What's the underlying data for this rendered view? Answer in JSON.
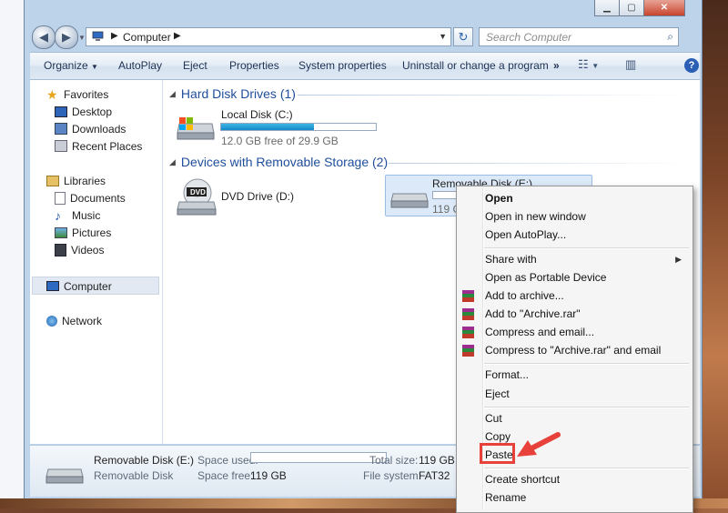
{
  "address": {
    "crumb": "Computer"
  },
  "search": {
    "placeholder": "Search Computer"
  },
  "toolbar": {
    "organize": "Organize",
    "autoplay": "AutoPlay",
    "eject": "Eject",
    "properties": "Properties",
    "system_properties": "System properties",
    "uninstall": "Uninstall or change a program",
    "more": "»"
  },
  "nav": {
    "favorites": "Favorites",
    "desktop": "Desktop",
    "downloads": "Downloads",
    "recent_places": "Recent Places",
    "libraries": "Libraries",
    "documents": "Documents",
    "music": "Music",
    "pictures": "Pictures",
    "videos": "Videos",
    "computer": "Computer",
    "network": "Network"
  },
  "groups": {
    "hdd": "Hard Disk Drives (1)",
    "removable": "Devices with Removable Storage (2)"
  },
  "drives": {
    "local_name": "Local Disk (C:)",
    "local_free": "12.0 GB free of 29.9 GB",
    "local_used_fraction": 0.6,
    "dvd_name": "DVD Drive (D:)",
    "rem_name": "Removable Disk (E:)",
    "rem_free_partial": "119 G",
    "dvd_badge": "DVD"
  },
  "status": {
    "name": "Removable Disk (E:)",
    "type": "Removable Disk",
    "space_used_label": "Space used:",
    "space_free_label": "Space free:",
    "space_free": "119 GB",
    "total_size_label": "Total size:",
    "total_size": "119 GB",
    "file_system_label": "File system:",
    "file_system": "FAT32"
  },
  "menu": {
    "open": "Open",
    "open_new_window": "Open in new window",
    "open_autoplay": "Open AutoPlay...",
    "share_with": "Share with",
    "open_portable": "Open as Portable Device",
    "add_archive": "Add to archive...",
    "add_archive_rar": "Add to \"Archive.rar\"",
    "compress_email": "Compress and email...",
    "compress_rar_email": "Compress to \"Archive.rar\" and email",
    "format": "Format...",
    "eject": "Eject",
    "cut": "Cut",
    "copy": "Copy",
    "paste": "Paste",
    "create_shortcut": "Create shortcut",
    "rename": "Rename"
  },
  "colors": {
    "highlight_box": "#e8403a",
    "link_blue": "#1f4e9c",
    "progress_fill": "#1889c7"
  }
}
